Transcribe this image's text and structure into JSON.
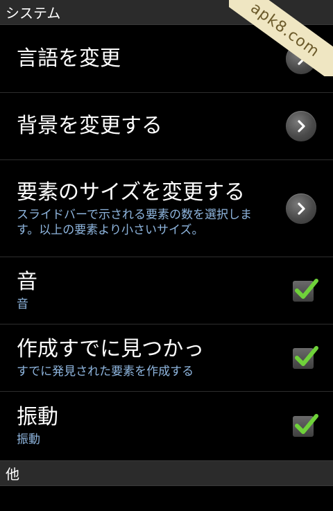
{
  "sections": {
    "system_header": "システム",
    "other_header": "他"
  },
  "watermark": {
    "text": "apk8.com"
  },
  "items": [
    {
      "title": "言語を変更",
      "summary": "",
      "control": "chevron-right-icon"
    },
    {
      "title": "背景を変更する",
      "summary": "",
      "control": "chevron-right-icon"
    },
    {
      "title": "要素のサイズを変更する",
      "summary": "スライドバーで示される要素の数を選択します。以上の要素より小さいサイズ。",
      "control": "chevron-right-icon"
    },
    {
      "title": "音",
      "summary": "音",
      "control": "checkbox",
      "checked": true
    },
    {
      "title": "作成すでに見つかっ",
      "summary": "すでに発見された要素を作成する",
      "control": "checkbox",
      "checked": true
    },
    {
      "title": "振動",
      "summary": "振動",
      "control": "checkbox",
      "checked": true
    }
  ],
  "colors": {
    "background": "#000000",
    "header_background": "#2b2b2b",
    "summary_text": "#8fb6df",
    "check_green": "#6fd23a"
  }
}
